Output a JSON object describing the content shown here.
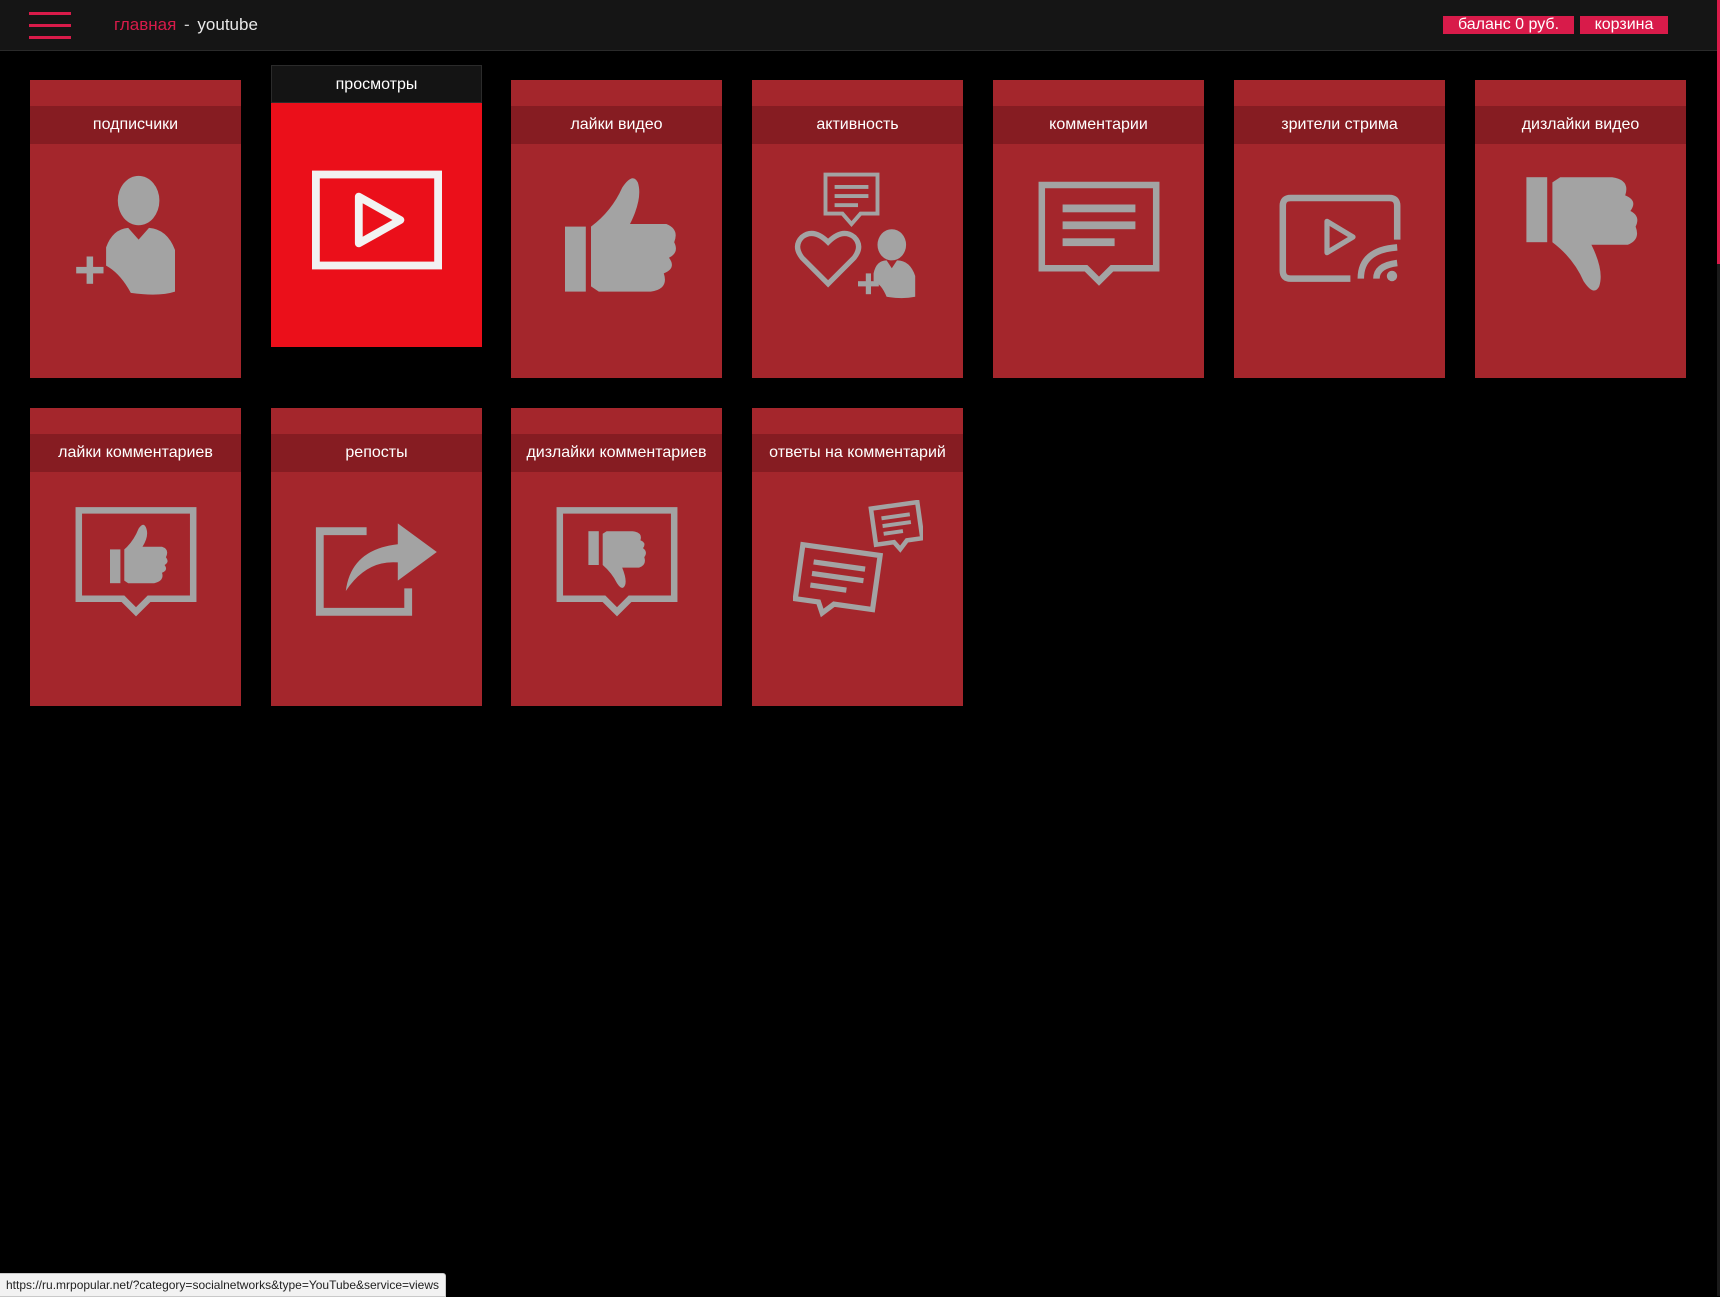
{
  "header": {
    "breadcrumb_home": "главная",
    "breadcrumb_separator": "-",
    "breadcrumb_current": "youtube",
    "balance_label": "баланс 0 руб.",
    "cart_label": "корзина"
  },
  "services": [
    {
      "label": "подписчики",
      "icon": "add-user-icon"
    },
    {
      "label": "просмотры",
      "icon": "play-icon"
    },
    {
      "label": "лайки видео",
      "icon": "thumbs-up-icon"
    },
    {
      "label": "активность",
      "icon": "activity-icon"
    },
    {
      "label": "комментарии",
      "icon": "comment-icon"
    },
    {
      "label": "зрители стрима",
      "icon": "stream-icon"
    },
    {
      "label": "дизлайки видео",
      "icon": "thumbs-down-icon"
    },
    {
      "label": "лайки комментариев",
      "icon": "comment-like-icon"
    },
    {
      "label": "репосты",
      "icon": "share-icon"
    },
    {
      "label": "дизлайки комментариев",
      "icon": "comment-dislike-icon"
    },
    {
      "label": "ответы на комментарий",
      "icon": "comment-reply-icon"
    }
  ],
  "status_bar_url": "https://ru.mrpopular.net/?category=socialnetworks&type=YouTube&service=views",
  "colors": {
    "accent": "#d81b4a",
    "card": "#a4262c",
    "card_title": "#861c22",
    "card_active": "#eb0f1a",
    "icon": "#a3a3a3",
    "icon_active": "#f2f2f2"
  }
}
